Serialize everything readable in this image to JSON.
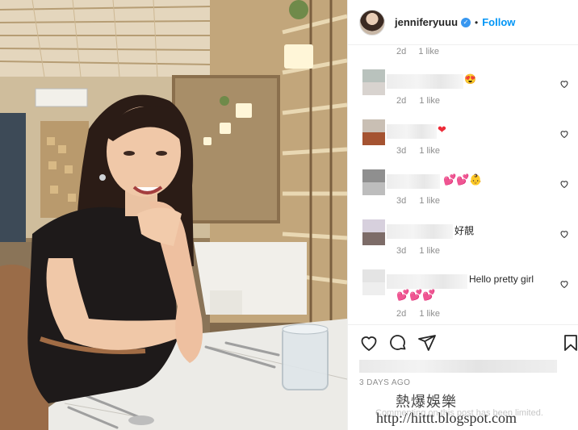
{
  "post": {
    "username": "jenniferyuuu",
    "verified_mark": "✓",
    "separator": "•",
    "follow_label": "Follow",
    "first_meta": {
      "time": "2d",
      "likes": "1 like"
    },
    "comments": [
      {
        "text": "",
        "emoji": "😍",
        "time": "2d",
        "likes": "1 like"
      },
      {
        "text": "",
        "emoji": "❤",
        "time": "3d",
        "likes": "1 like"
      },
      {
        "text": "",
        "emoji": "💕💕👶",
        "time": "3d",
        "likes": "1 like"
      },
      {
        "text": "好靚",
        "emoji": "",
        "time": "3d",
        "likes": "1 like"
      },
      {
        "text": "Hello pretty girl",
        "emoji": "💕💕💕",
        "time": "2d",
        "likes": "1 like"
      }
    ],
    "time_ago": "3 DAYS AGO",
    "comments_limited": "Commenting on this post has been limited."
  },
  "watermark": {
    "title": "熱爆娛樂",
    "url": "http://hittt.blogspot.com"
  },
  "icons": {
    "header_avatar": "profile-avatar",
    "like": "heart-outline-icon",
    "comment": "comment-bubble-icon",
    "share": "paper-plane-icon",
    "save": "bookmark-icon"
  },
  "colors": {
    "accent": "#0095f6",
    "verified": "#3897f0",
    "heart": "#ed2b38"
  }
}
